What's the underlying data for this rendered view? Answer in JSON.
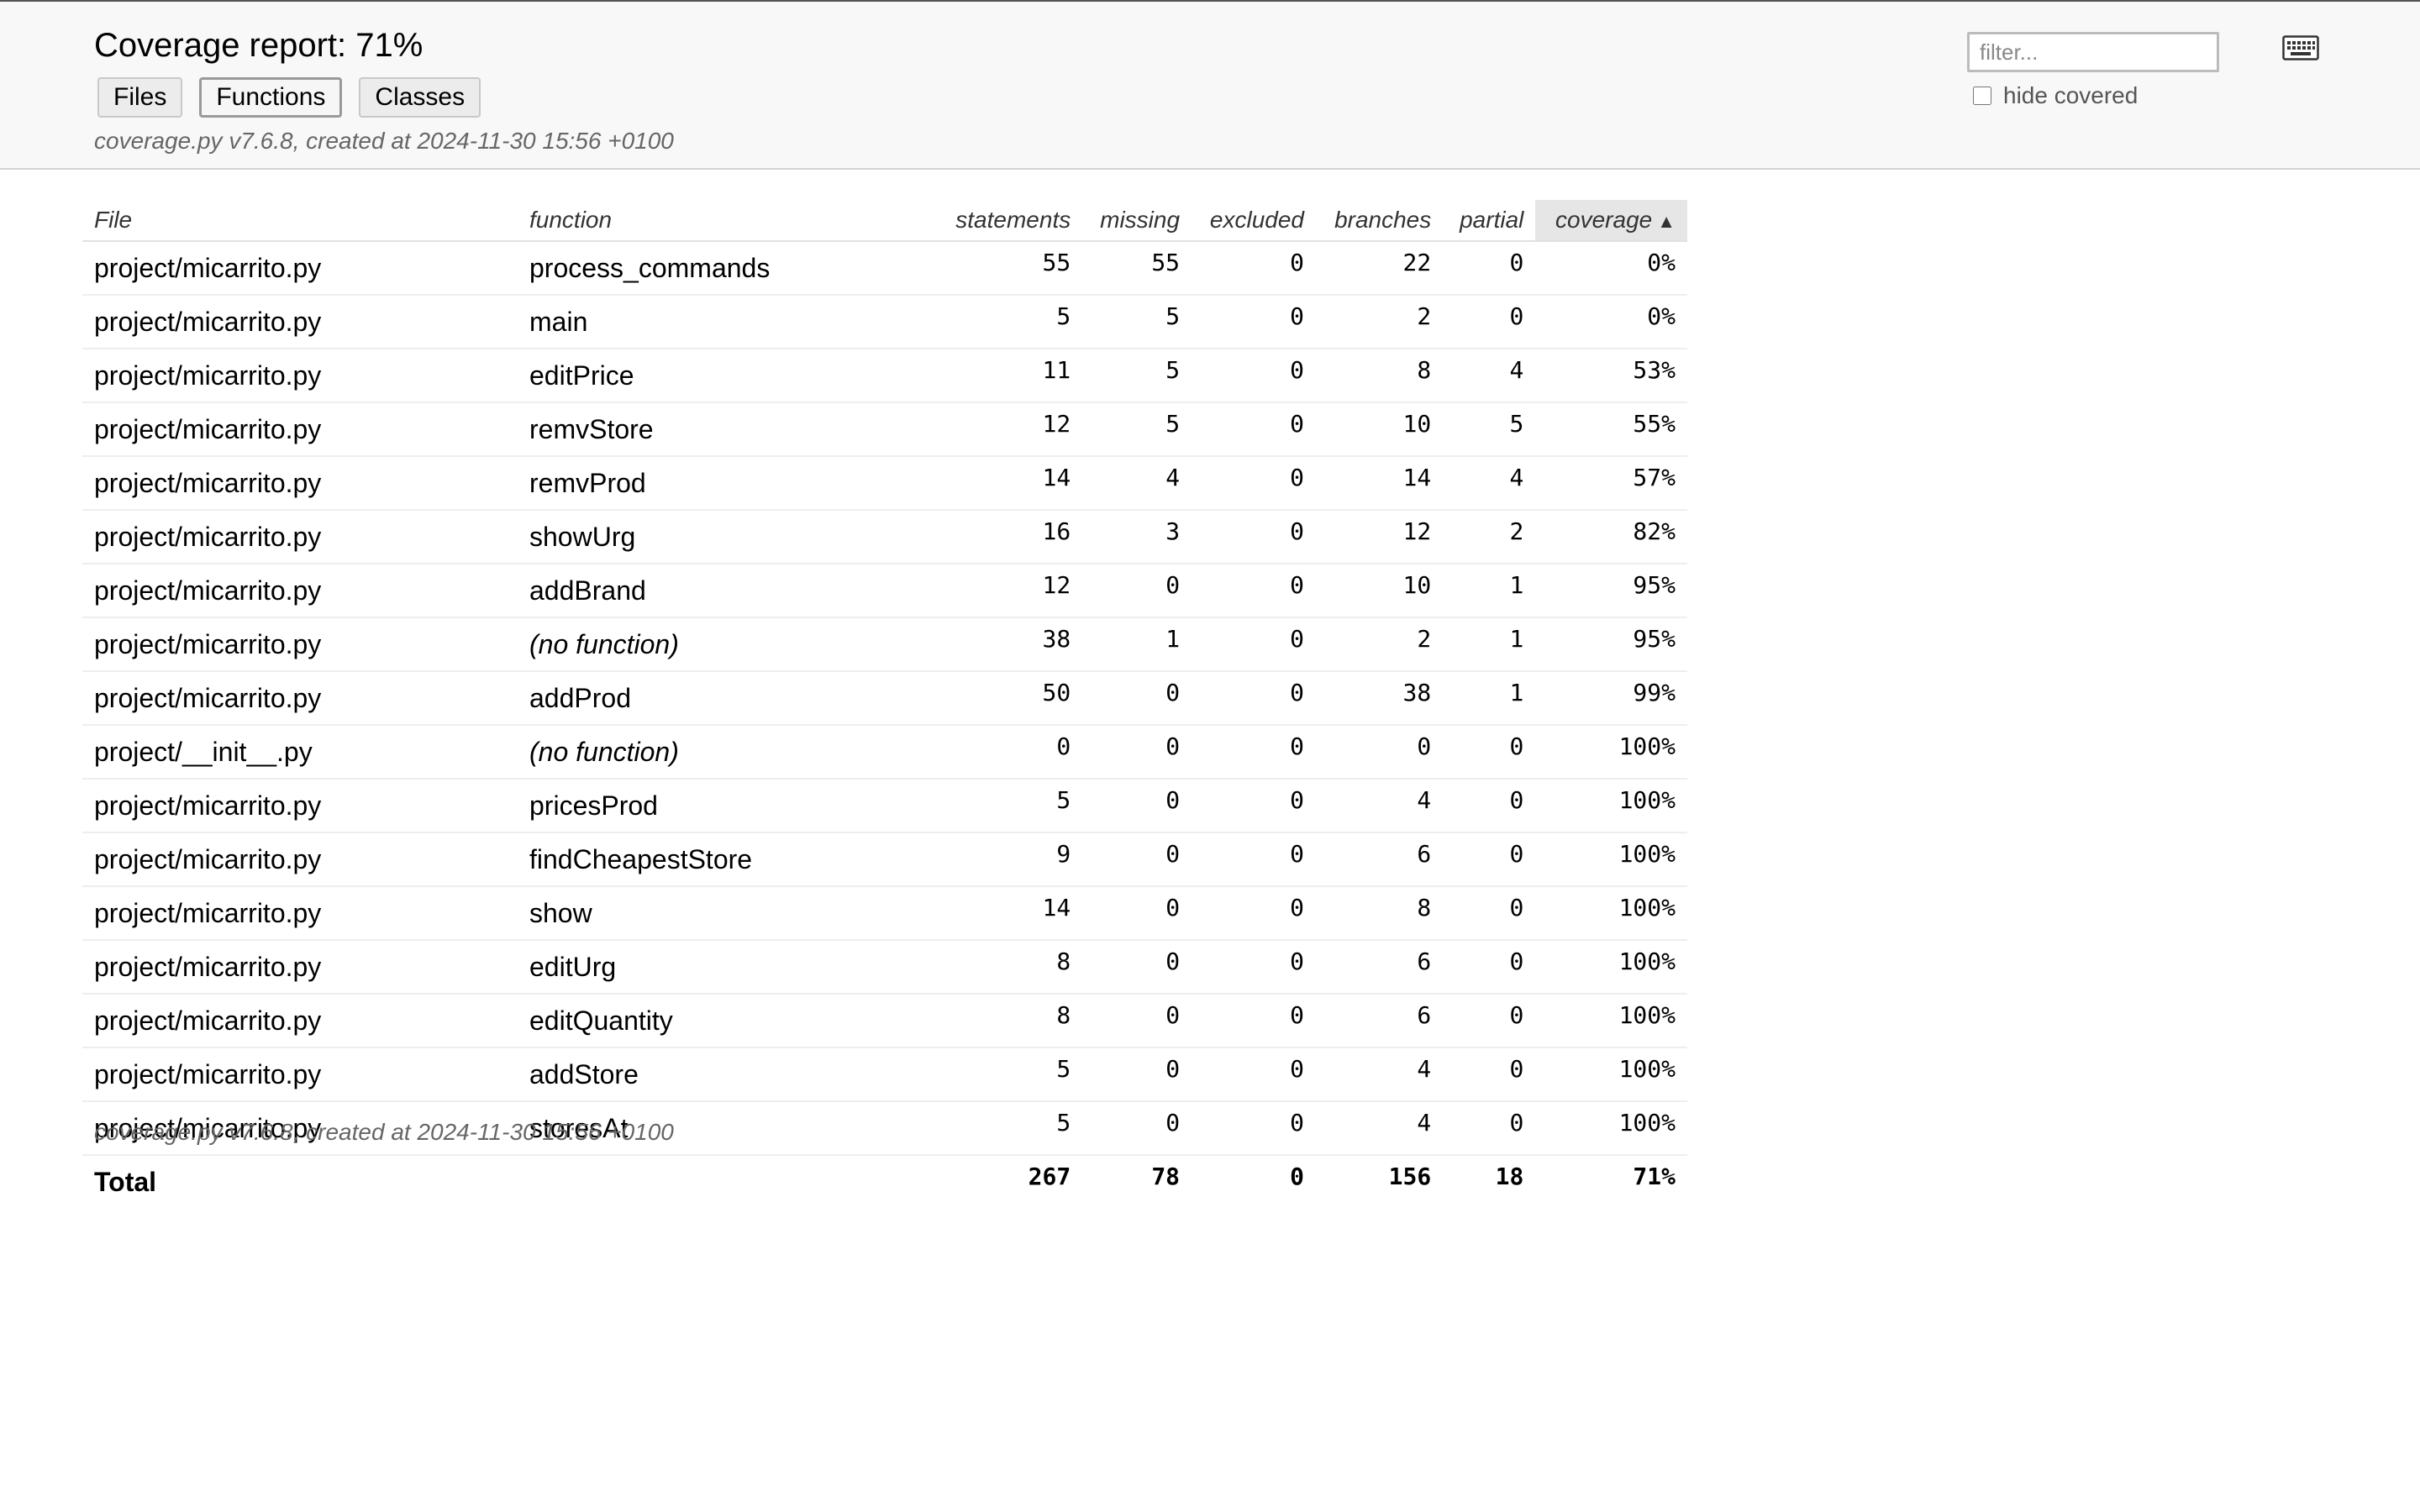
{
  "header": {
    "title": "Coverage report: 71%",
    "nav": [
      "Files",
      "Functions",
      "Classes"
    ],
    "active_nav": "Functions",
    "created": "coverage.py v7.6.8, created at 2024-11-30 15:56 +0100",
    "filter_placeholder": "filter...",
    "hide_covered_label": "hide covered",
    "keyboard_icon": "keyboard-icon"
  },
  "table": {
    "columns": [
      "File",
      "function",
      "statements",
      "missing",
      "excluded",
      "branches",
      "partial",
      "coverage"
    ],
    "sorted_column": "coverage",
    "sort_direction": "ascending",
    "rows": [
      {
        "file": "project/micarrito.py",
        "function": "process_commands",
        "statements": "55",
        "missing": "55",
        "excluded": "0",
        "branches": "22",
        "partial": "0",
        "coverage": "0%"
      },
      {
        "file": "project/micarrito.py",
        "function": "main",
        "statements": "5",
        "missing": "5",
        "excluded": "0",
        "branches": "2",
        "partial": "0",
        "coverage": "0%"
      },
      {
        "file": "project/micarrito.py",
        "function": "editPrice",
        "statements": "11",
        "missing": "5",
        "excluded": "0",
        "branches": "8",
        "partial": "4",
        "coverage": "53%"
      },
      {
        "file": "project/micarrito.py",
        "function": "remvStore",
        "statements": "12",
        "missing": "5",
        "excluded": "0",
        "branches": "10",
        "partial": "5",
        "coverage": "55%"
      },
      {
        "file": "project/micarrito.py",
        "function": "remvProd",
        "statements": "14",
        "missing": "4",
        "excluded": "0",
        "branches": "14",
        "partial": "4",
        "coverage": "57%"
      },
      {
        "file": "project/micarrito.py",
        "function": "showUrg",
        "statements": "16",
        "missing": "3",
        "excluded": "0",
        "branches": "12",
        "partial": "2",
        "coverage": "82%"
      },
      {
        "file": "project/micarrito.py",
        "function": "addBrand",
        "statements": "12",
        "missing": "0",
        "excluded": "0",
        "branches": "10",
        "partial": "1",
        "coverage": "95%"
      },
      {
        "file": "project/micarrito.py",
        "function": "(no function)",
        "italic": true,
        "statements": "38",
        "missing": "1",
        "excluded": "0",
        "branches": "2",
        "partial": "1",
        "coverage": "95%"
      },
      {
        "file": "project/micarrito.py",
        "function": "addProd",
        "statements": "50",
        "missing": "0",
        "excluded": "0",
        "branches": "38",
        "partial": "1",
        "coverage": "99%"
      },
      {
        "file": "project/__init__.py",
        "function": "(no function)",
        "italic": true,
        "statements": "0",
        "missing": "0",
        "excluded": "0",
        "branches": "0",
        "partial": "0",
        "coverage": "100%"
      },
      {
        "file": "project/micarrito.py",
        "function": "pricesProd",
        "statements": "5",
        "missing": "0",
        "excluded": "0",
        "branches": "4",
        "partial": "0",
        "coverage": "100%"
      },
      {
        "file": "project/micarrito.py",
        "function": "findCheapestStore",
        "statements": "9",
        "missing": "0",
        "excluded": "0",
        "branches": "6",
        "partial": "0",
        "coverage": "100%"
      },
      {
        "file": "project/micarrito.py",
        "function": "show",
        "statements": "14",
        "missing": "0",
        "excluded": "0",
        "branches": "8",
        "partial": "0",
        "coverage": "100%"
      },
      {
        "file": "project/micarrito.py",
        "function": "editUrg",
        "statements": "8",
        "missing": "0",
        "excluded": "0",
        "branches": "6",
        "partial": "0",
        "coverage": "100%"
      },
      {
        "file": "project/micarrito.py",
        "function": "editQuantity",
        "statements": "8",
        "missing": "0",
        "excluded": "0",
        "branches": "6",
        "partial": "0",
        "coverage": "100%"
      },
      {
        "file": "project/micarrito.py",
        "function": "addStore",
        "statements": "5",
        "missing": "0",
        "excluded": "0",
        "branches": "4",
        "partial": "0",
        "coverage": "100%"
      },
      {
        "file": "project/micarrito.py",
        "function": "storesAt",
        "statements": "5",
        "missing": "0",
        "excluded": "0",
        "branches": "4",
        "partial": "0",
        "coverage": "100%"
      }
    ],
    "total": {
      "label": "Total",
      "statements": "267",
      "missing": "78",
      "excluded": "0",
      "branches": "156",
      "partial": "18",
      "coverage": "71%"
    }
  },
  "footer": {
    "created": "coverage.py v7.6.8, created at 2024-11-30 15:56 +0100"
  }
}
